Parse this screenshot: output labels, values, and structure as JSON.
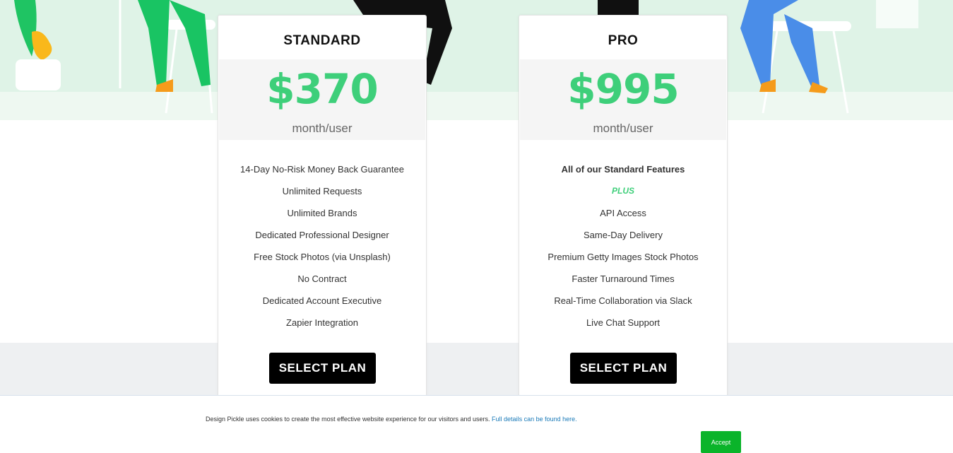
{
  "plans": [
    {
      "name": "STANDARD",
      "price": "$370",
      "period": "month/user",
      "features": [
        "14-Day No-Risk Money Back Guarantee",
        "Unlimited Requests",
        "Unlimited Brands",
        "Dedicated Professional Designer",
        "Free Stock Photos (via Unsplash)",
        "No Contract",
        "Dedicated Account Executive",
        "Zapier Integration"
      ],
      "button": "SELECT PLAN"
    },
    {
      "name": "PRO",
      "price": "$995",
      "period": "month/user",
      "features_heading": "All of our Standard Features",
      "features_plus": "PLUS",
      "features": [
        "API Access",
        "Same-Day Delivery",
        "Premium Getty Images Stock Photos",
        "Faster Turnaround Times",
        "Real-Time Collaboration via Slack",
        "Live Chat Support"
      ],
      "button": "SELECT PLAN"
    }
  ],
  "cookie": {
    "text": "Design Pickle uses cookies to create the most effective website experience for our visitors and users.",
    "link": "Full details can be found here.",
    "accept": "Accept"
  },
  "colors": {
    "accent_green": "#3ecf7a",
    "hero_bg": "#dff3e7",
    "accept_green": "#0ab42a"
  }
}
